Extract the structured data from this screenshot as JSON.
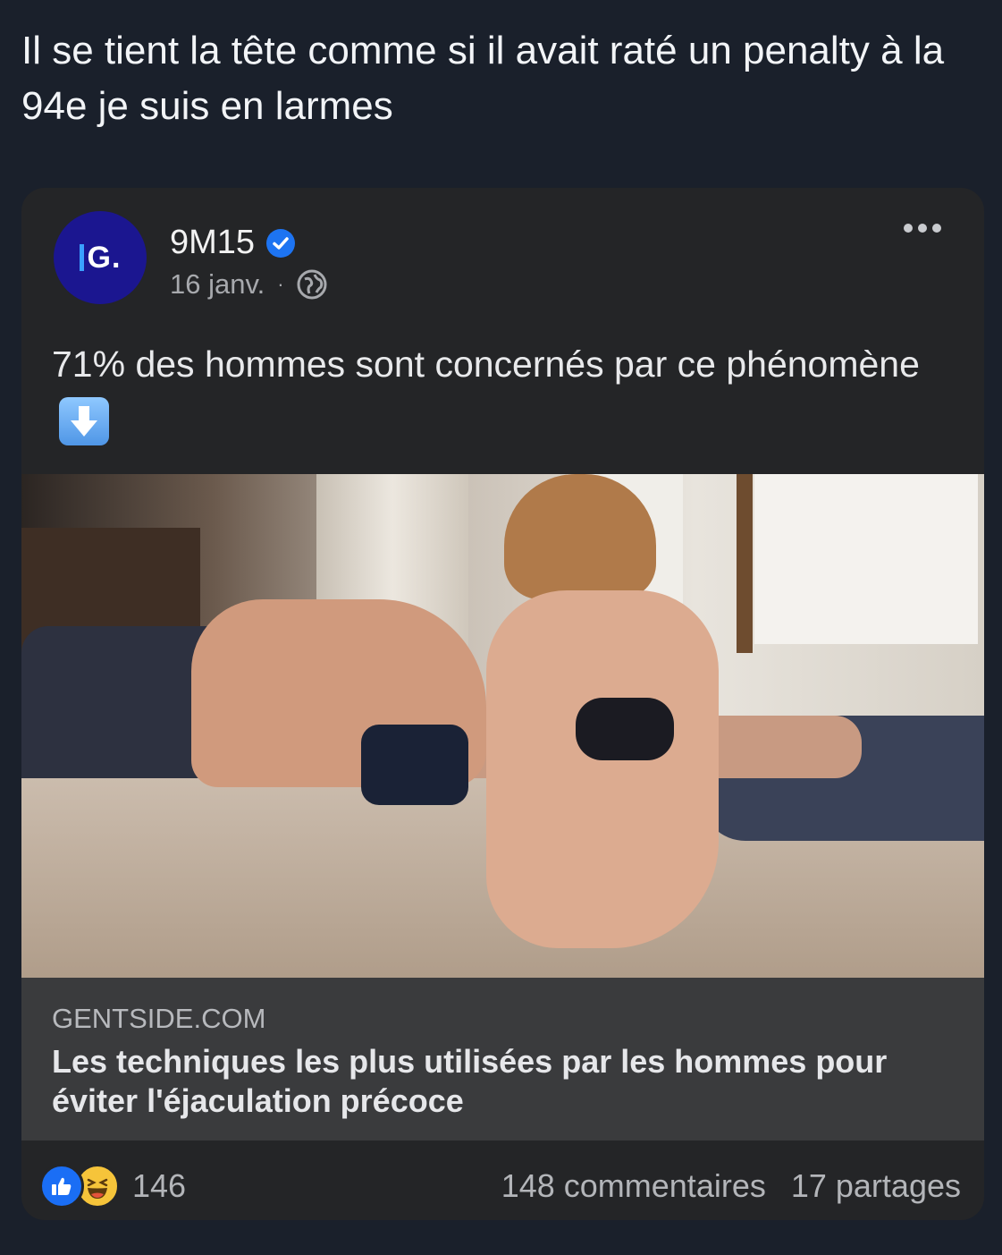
{
  "tweet": {
    "text": "Il se tient la tête comme si il avait raté un penalty à la 94e je suis en larmes"
  },
  "post": {
    "avatar_text": "G.",
    "author": "9M15",
    "date": "16 janv.",
    "separator": "·",
    "text": "71% des hommes sont concernés par ce phénomène",
    "emoji": "down-arrow-emoji"
  },
  "link": {
    "domain": "GENTSIDE.COM",
    "title": "Les techniques les plus utilisées par les hommes pour éviter l'éjaculation précoce"
  },
  "stats": {
    "reactions": "146",
    "comments": "148 commentaires",
    "shares": "17 partages"
  },
  "colors": {
    "background": "#1a202b",
    "card": "#242527",
    "link_box": "#3a3b3d",
    "avatar": "#1b1690",
    "verified": "#1d74f2",
    "like": "#1a6ef5",
    "haha": "#f6c43a"
  },
  "icons": [
    "verified-icon",
    "globe-icon",
    "more-options-icon",
    "down-arrow-emoji",
    "like-reaction-icon",
    "haha-reaction-icon"
  ]
}
